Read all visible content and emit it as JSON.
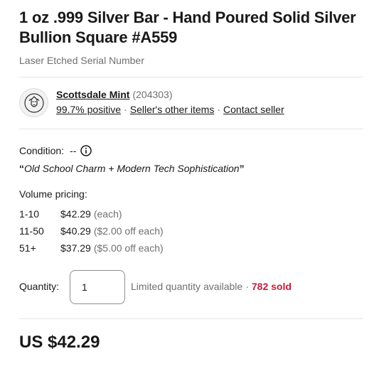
{
  "listing": {
    "title": "1 oz .999 Silver Bar - Hand Poured Solid Silver Bullion Square #A559",
    "subtitle": "Laser Etched Serial Number"
  },
  "seller": {
    "logo_icon": "mint-logo-icon",
    "name": "Scottsdale Mint",
    "feedback_count": "(204303)",
    "positive": "99.7% positive",
    "other_items": "Seller's other items",
    "contact": "Contact seller",
    "separator": "·"
  },
  "condition": {
    "label": "Condition:",
    "value": "--",
    "info_icon": "info-icon"
  },
  "quote": {
    "open": "“",
    "text": "Old School Charm + Modern Tech Sophistication",
    "close": "”"
  },
  "volume_pricing": {
    "label": "Volume pricing:",
    "tiers": [
      {
        "range": "1-10",
        "price": "$42.29",
        "note": "(each)"
      },
      {
        "range": "11-50",
        "price": "$40.29",
        "note": "($2.00 off each)"
      },
      {
        "range": "51+",
        "price": "$37.29",
        "note": "($5.00 off each)"
      }
    ]
  },
  "quantity": {
    "label": "Quantity:",
    "value": "1",
    "availability": "Limited quantity available",
    "separator": "·",
    "sold": "782 sold"
  },
  "price": {
    "display": "US $42.29"
  },
  "colors": {
    "text": "#191919",
    "muted": "#707070",
    "sold_red": "#c41e3a",
    "divider": "#e5e5e5"
  }
}
